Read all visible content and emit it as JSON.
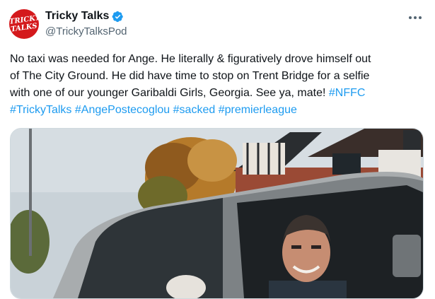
{
  "account": {
    "display_name": "Tricky Talks",
    "handle": "@TrickyTalksPod",
    "verified": true,
    "avatar_logo_text": [
      "TRICKY",
      "TALKS"
    ],
    "verified_color": "#1d9bf0"
  },
  "tweet": {
    "text_segments": [
      "No taxi was needed for Ange. He literally & figuratively drove himself out",
      "of The City Ground. He did have time to stop on Trent Bridge for a selfie",
      "with one of our younger Garibaldi Girls, Georgia. See ya, mate!"
    ],
    "hashtags": [
      "#NFFC",
      "#TrickyTalks",
      "#AngePostecoglou",
      "#sacked",
      "#premierleague"
    ],
    "link_color": "#1d9bf0"
  },
  "media": {
    "description_icon": "photo-of-man-in-car-icon"
  },
  "icons": {
    "more": "more-horizontal-icon",
    "verified": "verified-badge-icon"
  }
}
